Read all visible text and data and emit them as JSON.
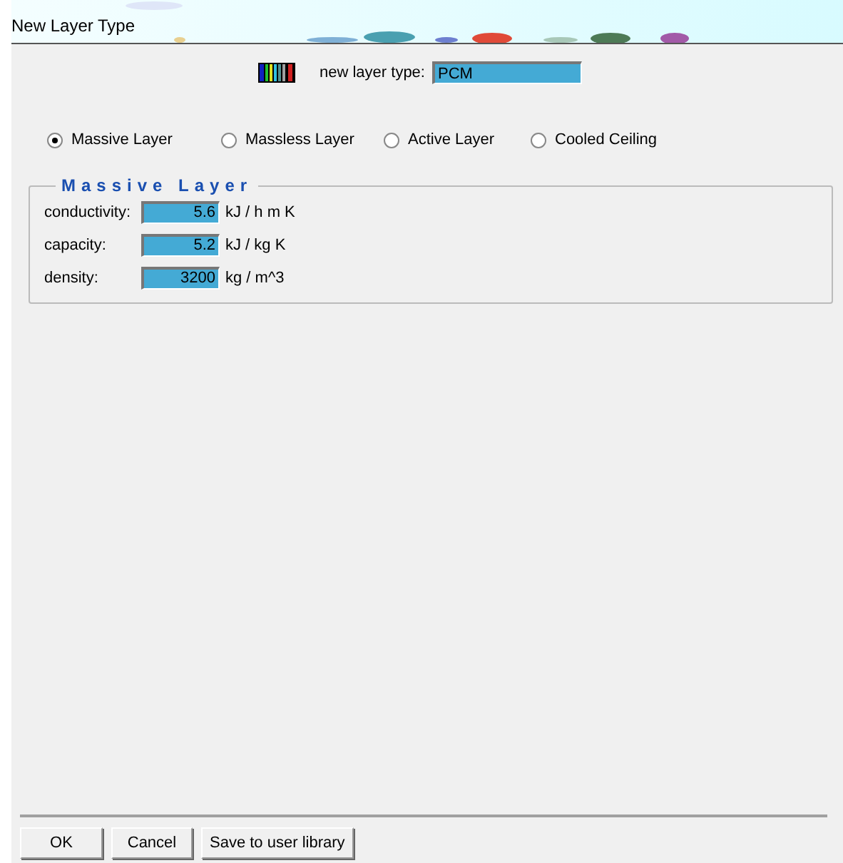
{
  "window": {
    "title": "New Layer Type"
  },
  "layer_type": {
    "label": "new layer type:",
    "value": "PCM"
  },
  "options": [
    {
      "label": "Massive Layer",
      "selected": true
    },
    {
      "label": "Massless Layer",
      "selected": false
    },
    {
      "label": "Active Layer",
      "selected": false
    },
    {
      "label": "Cooled Ceiling",
      "selected": false
    }
  ],
  "group": {
    "title": "Massive Layer",
    "fields": [
      {
        "label": "conductivity:",
        "value": "5.6",
        "unit": "kJ / h m K"
      },
      {
        "label": "capacity:",
        "value": "5.2",
        "unit": "kJ / kg K"
      },
      {
        "label": "density:",
        "value": "3200",
        "unit": "kg / m^3"
      }
    ]
  },
  "buttons": [
    "OK",
    "Cancel",
    "Save to user library"
  ]
}
